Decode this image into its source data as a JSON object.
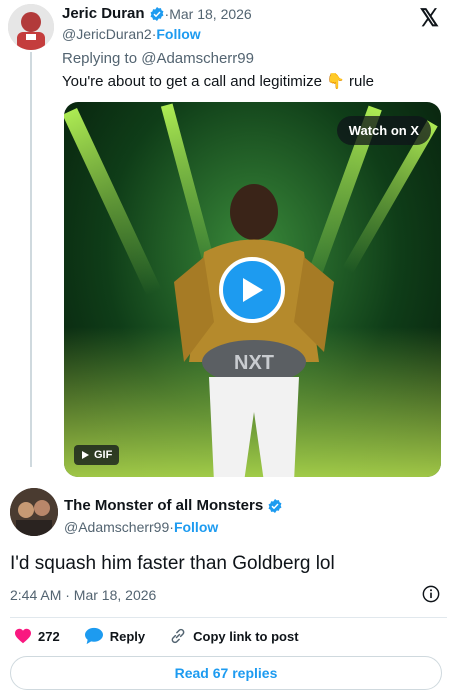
{
  "first_tweet": {
    "name": "Jeric Duran",
    "handle": "@JericDuran2",
    "date": "Mar 18, 2026",
    "follow_label": "Follow",
    "replying_to": "Replying to @Adamscherr99",
    "text_before": "You're about to get a call and legitimize ",
    "emoji": "👇",
    "text_after": " rule",
    "media": {
      "watch_label": "Watch on X",
      "gif_label": "GIF"
    }
  },
  "reply_tweet": {
    "name": "The Monster of all Monsters",
    "handle": "@Adamscherr99",
    "follow_label": "Follow",
    "text": "I'd squash him faster than Goldberg lol",
    "timestamp": "2:44 AM · Mar 18, 2026"
  },
  "actions": {
    "like_count": "272",
    "reply_label": "Reply",
    "copy_label": "Copy link to post"
  },
  "read_replies_label": "Read 67 replies",
  "brand": {
    "x_logo": "𝕏",
    "accent_color": "#1d9bf0",
    "like_color": "#f91880"
  },
  "separator": " · "
}
